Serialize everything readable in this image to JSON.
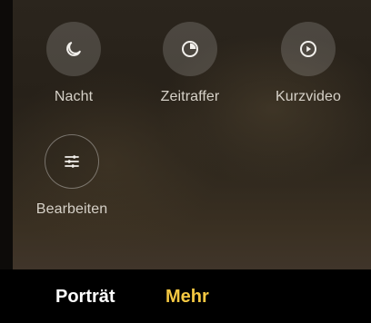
{
  "modes": [
    {
      "label": "Nacht",
      "icon": "moon-icon"
    },
    {
      "label": "Zeitraffer",
      "icon": "timer-icon"
    },
    {
      "label": "Kurzvideo",
      "icon": "play-circle-icon"
    },
    {
      "label": "Bearbeiten",
      "icon": "sliders-icon"
    }
  ],
  "bottom_tabs": [
    {
      "label": "Porträt",
      "active": false
    },
    {
      "label": "Mehr",
      "active": true
    }
  ],
  "colors": {
    "active_tab": "#f5c842",
    "inactive_tab": "#ffffff",
    "label": "#d6d1c8"
  }
}
